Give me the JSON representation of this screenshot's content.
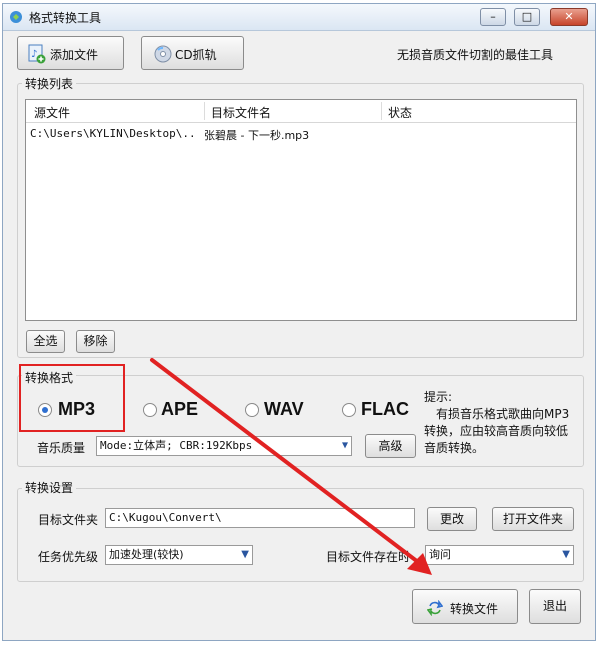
{
  "window": {
    "title": "格式转换工具",
    "controls": {
      "minimize": "–",
      "maximize": "□",
      "close": "✕"
    }
  },
  "toolbar": {
    "add_file": "添加文件",
    "cd_rip": "CD抓轨",
    "tagline": "无损音质文件切割的最佳工具"
  },
  "convert_list": {
    "legend": "转换列表",
    "columns": [
      "源文件",
      "目标文件名",
      "状态"
    ],
    "rows": [
      {
        "source": "C:\\Users\\KYLIN\\Desktop\\..",
        "target": "张碧晨 - 下一秒.mp3",
        "status": ""
      }
    ],
    "select_all": "全选",
    "remove": "移除"
  },
  "format": {
    "legend": "转换格式",
    "options": [
      "MP3",
      "APE",
      "WAV",
      "FLAC"
    ],
    "selected": "MP3",
    "quality_label": "音乐质量",
    "quality_value": "Mode:立体声; CBR:192Kbps",
    "advanced": "高级",
    "hint_title": "提示:",
    "hint_text": "有损音乐格式歌曲向MP3转换，应由较高音质向较低音质转换。"
  },
  "settings": {
    "legend": "转换设置",
    "target_folder_label": "目标文件夹",
    "target_folder_value": "C:\\Kugou\\Convert\\",
    "change": "更改",
    "open_folder": "打开文件夹",
    "priority_label": "任务优先级",
    "priority_value": "加速处理(较快)",
    "exists_label": "目标文件存在时",
    "exists_value": "询问"
  },
  "footer": {
    "convert": "转换文件",
    "exit": "退出"
  },
  "colors": {
    "highlight_box": "#e12222",
    "arrow": "#e12222",
    "accent": "#2f6fd0"
  }
}
